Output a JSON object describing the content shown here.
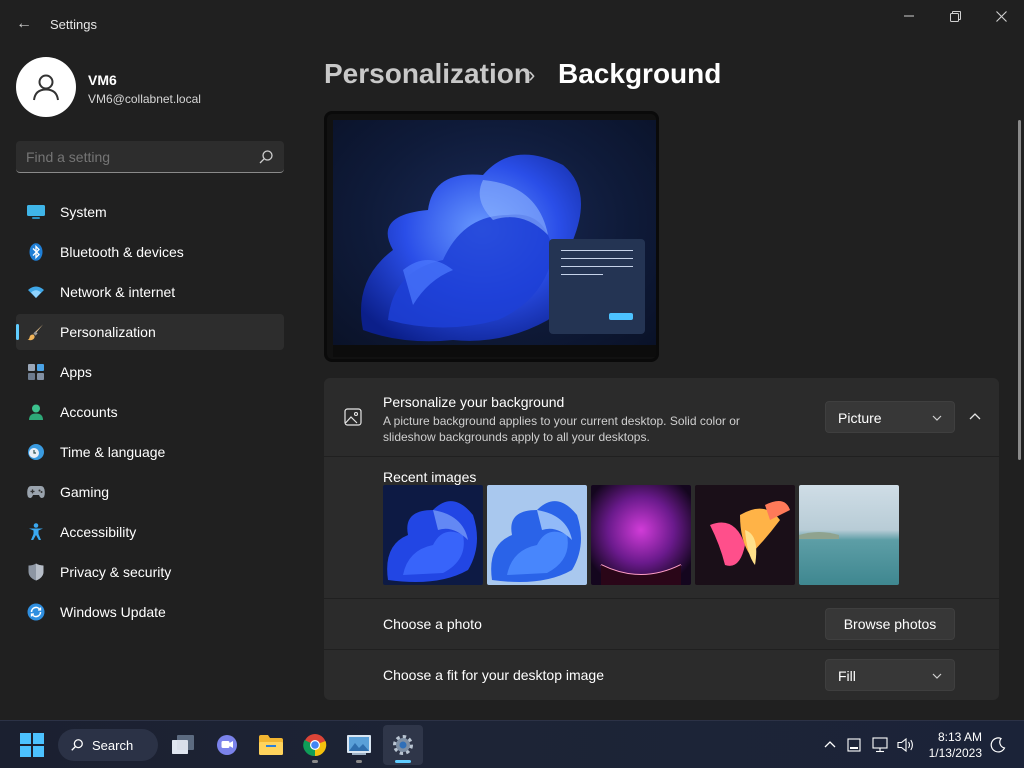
{
  "window": {
    "title": "Settings",
    "back_glyph": "←",
    "controls": {
      "minimize_glyph": "—",
      "maximize_glyph": "❐",
      "close_glyph": "✕"
    }
  },
  "profile": {
    "name": "VM6",
    "email": "VM6@collabnet.local"
  },
  "search": {
    "placeholder": "Find a setting"
  },
  "sidebar": {
    "items": [
      {
        "label": "System",
        "icon": "system-icon",
        "active": false
      },
      {
        "label": "Bluetooth & devices",
        "icon": "bluetooth-icon",
        "active": false
      },
      {
        "label": "Network & internet",
        "icon": "wifi-icon",
        "active": false
      },
      {
        "label": "Personalization",
        "icon": "brush-icon",
        "active": true
      },
      {
        "label": "Apps",
        "icon": "apps-icon",
        "active": false
      },
      {
        "label": "Accounts",
        "icon": "accounts-icon",
        "active": false
      },
      {
        "label": "Time & language",
        "icon": "clock-globe-icon",
        "active": false
      },
      {
        "label": "Gaming",
        "icon": "gamepad-icon",
        "active": false
      },
      {
        "label": "Accessibility",
        "icon": "accessibility-icon",
        "active": false
      },
      {
        "label": "Privacy & security",
        "icon": "shield-icon",
        "active": false
      },
      {
        "label": "Windows Update",
        "icon": "update-icon",
        "active": false
      }
    ]
  },
  "breadcrumb": {
    "parent": "Personalization",
    "separator": "›",
    "current": "Background"
  },
  "background": {
    "title": "Personalize your background",
    "description": "A picture background applies to your current desktop. Solid color or slideshow backgrounds apply to all your desktops.",
    "type_value": "Picture",
    "recent_label": "Recent images",
    "recent_images": [
      "bloom-dark-blue",
      "bloom-light-blue",
      "purple-glow",
      "colorful-ribbon",
      "lake-landscape"
    ],
    "choose_photo_label": "Choose a photo",
    "browse_button": "Browse photos",
    "fit_label": "Choose a fit for your desktop image",
    "fit_value": "Fill"
  },
  "taskbar": {
    "search_label": "Search",
    "time": "8:13 AM",
    "date": "1/13/2023"
  },
  "colors": {
    "accent": "#60cdff",
    "background": "#202020",
    "card": "#2b2b2b"
  }
}
